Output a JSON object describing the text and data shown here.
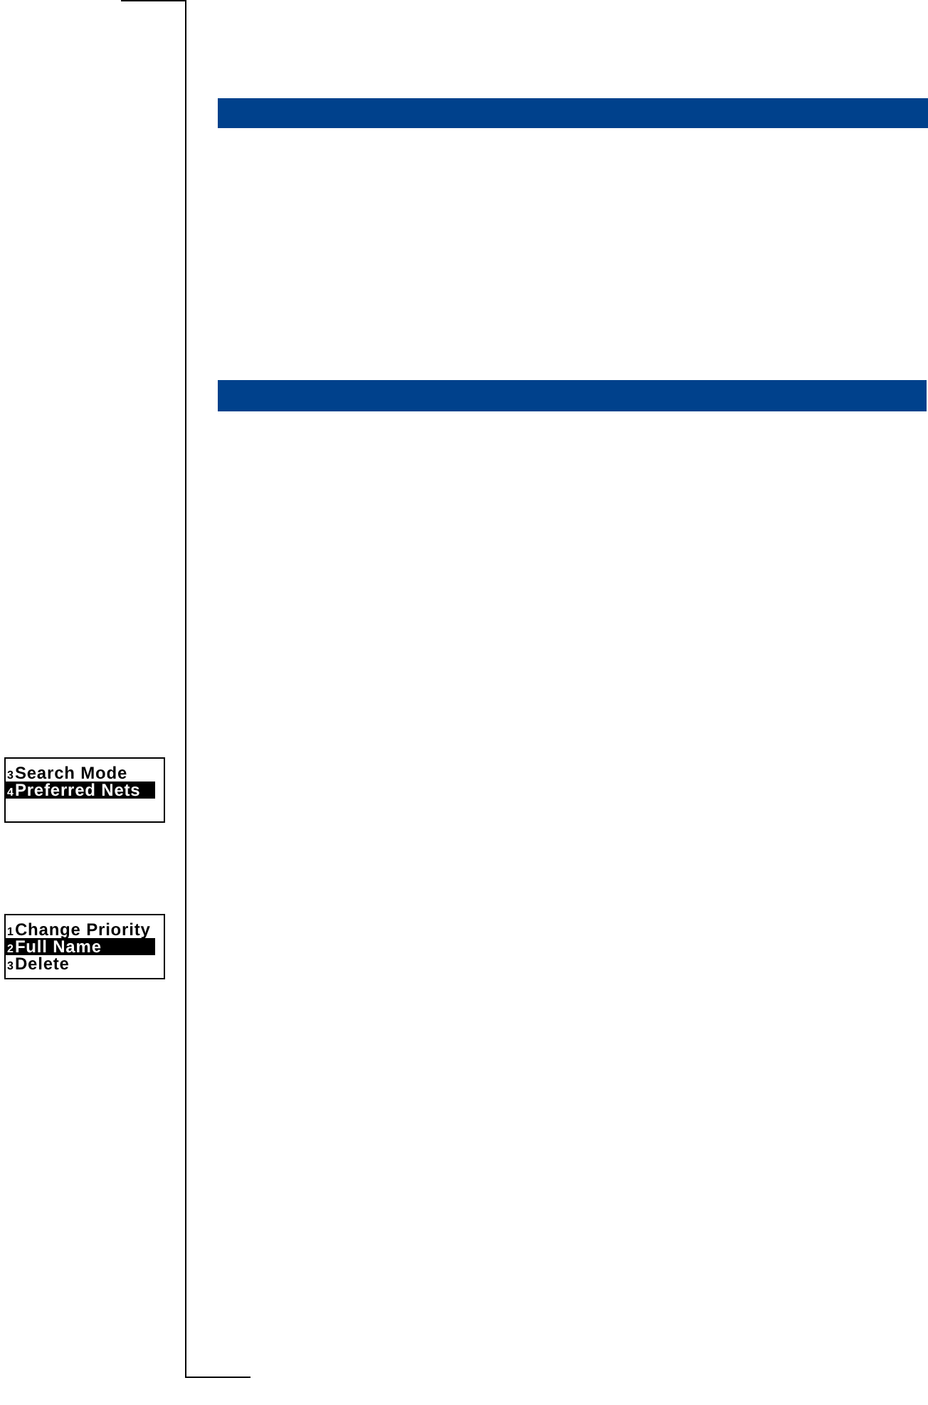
{
  "screens": [
    {
      "items": [
        {
          "number": "3",
          "label": "Search Mode",
          "selected": false
        },
        {
          "number": "4",
          "label": "Preferred Nets",
          "selected": true
        }
      ]
    },
    {
      "items": [
        {
          "number": "1",
          "label": "Change Priority",
          "selected": false
        },
        {
          "number": "2",
          "label": "Full Name",
          "selected": true
        },
        {
          "number": "3",
          "label": "Delete",
          "selected": false
        }
      ]
    }
  ]
}
